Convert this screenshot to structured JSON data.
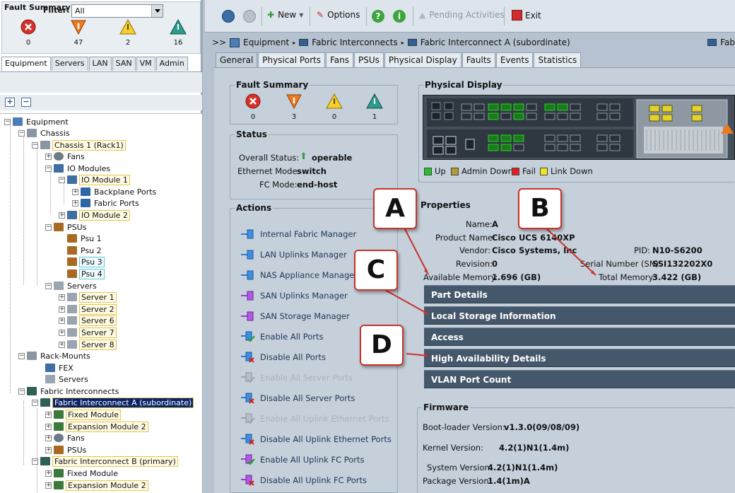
{
  "left": {
    "fault_summary": {
      "title": "Fault Summary",
      "counts": [
        "0",
        "47",
        "2",
        "16"
      ]
    },
    "tabs": [
      "Equipment",
      "Servers",
      "LAN",
      "SAN",
      "VM",
      "Admin"
    ],
    "filter": {
      "label": "Filter:",
      "value": "All"
    },
    "tree": [
      {
        "label": "Equipment"
      },
      {
        "label": "Chassis"
      },
      {
        "label": "Chassis 1 (Rack1)"
      },
      {
        "label": "Fans"
      },
      {
        "label": "IO Modules"
      },
      {
        "label": "IO Module 1"
      },
      {
        "label": "Backplane Ports"
      },
      {
        "label": "Fabric Ports"
      },
      {
        "label": "IO Module 2"
      },
      {
        "label": "PSUs"
      },
      {
        "label": "Psu 1"
      },
      {
        "label": "Psu 2"
      },
      {
        "label": "Psu 3"
      },
      {
        "label": "Psu 4"
      },
      {
        "label": "Servers"
      },
      {
        "label": "Server 1"
      },
      {
        "label": "Server 2"
      },
      {
        "label": "Server 6"
      },
      {
        "label": "Server 7"
      },
      {
        "label": "Server 8"
      },
      {
        "label": "Rack-Mounts"
      },
      {
        "label": "FEX"
      },
      {
        "label": "Servers"
      },
      {
        "label": "Fabric Interconnects"
      },
      {
        "label": "Fabric Interconnect A (subordinate)"
      },
      {
        "label": "Fixed Module"
      },
      {
        "label": "Expansion Module 2"
      },
      {
        "label": "Fans"
      },
      {
        "label": "PSUs"
      },
      {
        "label": "Fabric Interconnect B (primary)"
      },
      {
        "label": "Fixed Module"
      },
      {
        "label": "Expansion Module 2"
      }
    ]
  },
  "toolbar": {
    "new": "New",
    "options": "Options",
    "pending": "Pending Activities",
    "exit": "Exit"
  },
  "breadcrumb": {
    "prefix": ">>",
    "items": [
      "Equipment",
      "Fabric Interconnects",
      "Fabric Interconnect A (subordinate)"
    ],
    "right": "Fab"
  },
  "tabs": [
    "General",
    "Physical Ports",
    "Fans",
    "PSUs",
    "Physical Display",
    "Faults",
    "Events",
    "Statistics"
  ],
  "fault_summary": {
    "title": "Fault Summary",
    "counts": [
      "0",
      "3",
      "0",
      "1"
    ]
  },
  "status": {
    "title": "Status",
    "overall_label": "Overall Status:",
    "overall_value": "operable",
    "eth_label": "Ethernet Mode:",
    "eth_value": "switch",
    "fc_label": "FC Mode:",
    "fc_value": "end-host"
  },
  "actions": {
    "title": "Actions",
    "items": [
      "Internal Fabric Manager",
      "LAN Uplinks Manager",
      "NAS Appliance Manager",
      "SAN Uplinks Manager",
      "SAN Storage Manager",
      "Enable All Ports",
      "Disable All Ports",
      "Enable All Server Ports",
      "Disable All Server Ports",
      "Enable All Uplink Ethernet Ports",
      "Disable All Uplink Ethernet Ports",
      "Enable All Uplink FC Ports",
      "Disable All Uplink FC Ports"
    ]
  },
  "physical_display": {
    "title": "Physical Display",
    "legend": [
      "Up",
      "Admin Down",
      "Fail",
      "Link Down"
    ],
    "legend_colors": [
      "#21c12c",
      "#b69a2e",
      "#e02020",
      "#f2e51a"
    ]
  },
  "properties": {
    "title": "Properties",
    "name_label": "Name:",
    "name_value": "A",
    "product_label": "Product Name:",
    "product_value": "Cisco UCS 6140XP",
    "vendor_label": "Vendor:",
    "vendor_value": "Cisco Systems, Inc",
    "pid_label": "PID:",
    "pid_value": "N10-S6200",
    "revision_label": "Revision:",
    "revision_value": "0",
    "serial_label": "Serial Number (SN):",
    "serial_value": "SSI132202X0",
    "avail_label": "Available Memory:",
    "avail_value": "1.696 (GB)",
    "total_label": "Total Memory:",
    "total_value": "3.422 (GB)"
  },
  "sections": [
    "Part Details",
    "Local Storage Information",
    "Access",
    "High Availability Details",
    "VLAN Port Count"
  ],
  "firmware": {
    "title": "Firmware",
    "boot_label": "Boot-loader Version:",
    "boot_value": "v1.3.0(09/08/09)",
    "kernel_label": "Kernel Version:",
    "kernel_value": "4.2(1)N1(1.4m)",
    "system_label": "System Version:",
    "system_value": "4.2(1)N1(1.4m)",
    "package_label": "Package Version:",
    "package_value": "1.4(1m)A"
  },
  "callouts": [
    "A",
    "B",
    "C",
    "D"
  ]
}
